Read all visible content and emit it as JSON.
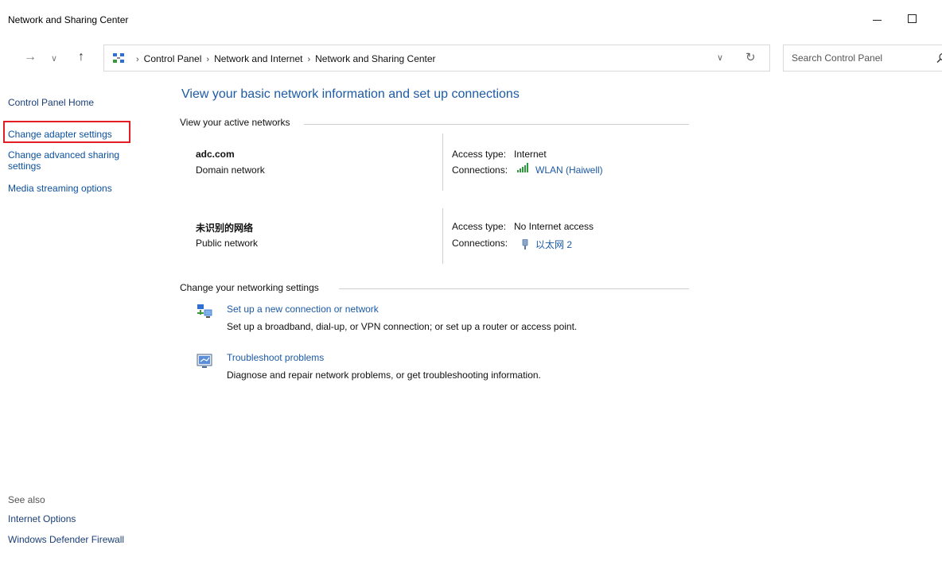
{
  "window": {
    "title": "Network and Sharing Center"
  },
  "address": {
    "crumbs": [
      "Control Panel",
      "Network and Internet",
      "Network and Sharing Center"
    ],
    "search_placeholder": "Search Control Panel"
  },
  "sidebar": {
    "home": "Control Panel Home",
    "adapter": "Change adapter settings",
    "advanced": "Change advanced sharing settings",
    "media": "Media streaming options",
    "see_also": "See also",
    "internet_options": "Internet Options",
    "firewall": "Windows Defender Firewall"
  },
  "main": {
    "title": "View your basic network information and set up connections",
    "active_networks_heading": "View your active networks",
    "networks": [
      {
        "name": "adc.com",
        "type": "Domain network",
        "access_label": "Access type:",
        "access_value": "Internet",
        "conn_label": "Connections:",
        "conn_value": "WLAN (Haiwell)"
      },
      {
        "name": "未识别的网络",
        "type": "Public network",
        "access_label": "Access type:",
        "access_value": "No Internet access",
        "conn_label": "Connections:",
        "conn_value": "以太网 2"
      }
    ],
    "change_heading": "Change your networking settings",
    "tasks": [
      {
        "link": "Set up a new connection or network",
        "desc": "Set up a broadband, dial-up, or VPN connection; or set up a router or access point."
      },
      {
        "link": "Troubleshoot problems",
        "desc": "Diagnose and repair network problems, or get troubleshooting information."
      }
    ]
  },
  "colors": {
    "link": "#1c5aa6",
    "highlight": "#e41d23"
  }
}
